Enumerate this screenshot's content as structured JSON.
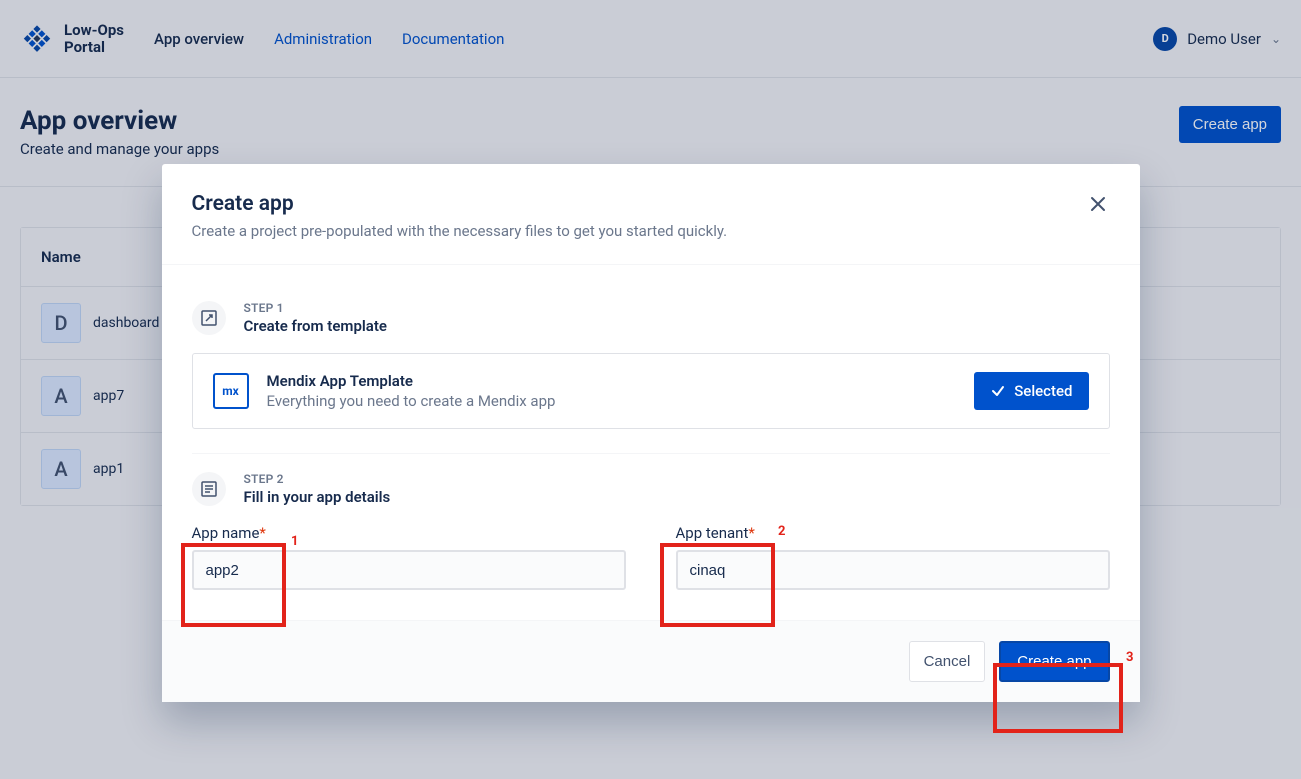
{
  "brand": {
    "line1": "Low-Ops",
    "line2": "Portal"
  },
  "nav": {
    "overview": "App overview",
    "admin": "Administration",
    "docs": "Documentation"
  },
  "user": {
    "initial": "D",
    "name": "Demo User"
  },
  "header": {
    "title": "App overview",
    "subtitle": "Create and manage your apps",
    "createBtn": "Create app"
  },
  "table": {
    "col1": "Name",
    "rows": [
      {
        "initial": "D",
        "name": "dashboard"
      },
      {
        "initial": "A",
        "name": "app7"
      },
      {
        "initial": "A",
        "name": "app1"
      }
    ]
  },
  "modal": {
    "title": "Create app",
    "subtitle": "Create a project pre-populated with the necessary files to get you started quickly.",
    "step1Label": "STEP 1",
    "step1Title": "Create from template",
    "template": {
      "badge": "mx",
      "title": "Mendix App Template",
      "desc": "Everything you need to create a Mendix app",
      "selected": "Selected"
    },
    "step2Label": "STEP 2",
    "step2Title": "Fill in your app details",
    "fields": {
      "nameLabel": "App name",
      "nameValue": "app2",
      "tenantLabel": "App tenant",
      "tenantValue": "cinaq"
    },
    "cancel": "Cancel",
    "submit": "Create app"
  },
  "annotations": {
    "a1": "1",
    "a2": "2",
    "a3": "3"
  }
}
